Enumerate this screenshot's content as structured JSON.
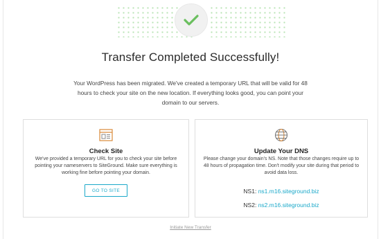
{
  "header": {
    "title": "Transfer Completed Successfully!",
    "intro": "Your WordPress has been migrated. We've created a temporary URL that will be valid for 48 hours to check your site on the new location. If everything looks good, you can point your domain to our servers."
  },
  "check_site": {
    "icon": "browser-window-icon",
    "title": "Check Site",
    "text": "We've provided a temporary URL for you to check your site before pointing your nameservers to SiteGround. Make sure everything is working fine before pointing your domain.",
    "button_label": "GO TO SITE"
  },
  "update_dns": {
    "icon": "globe-icon",
    "title": "Update Your DNS",
    "text": "Please change your domain's NS. Note that those changes require up to 48 hours of propagation time. Don't modify your site during that period to avoid data loss.",
    "ns1_label": "NS1:",
    "ns1_value": "ns1.m16.siteground.biz",
    "ns2_label": "NS2:",
    "ns2_value": "ns2.m16.siteground.biz"
  },
  "footer": {
    "link_label": "Initiate New Transfer"
  },
  "colors": {
    "accent": "#1aa8c9",
    "success_check": "#6abf5e",
    "icon_orange": "#d98a3a"
  }
}
